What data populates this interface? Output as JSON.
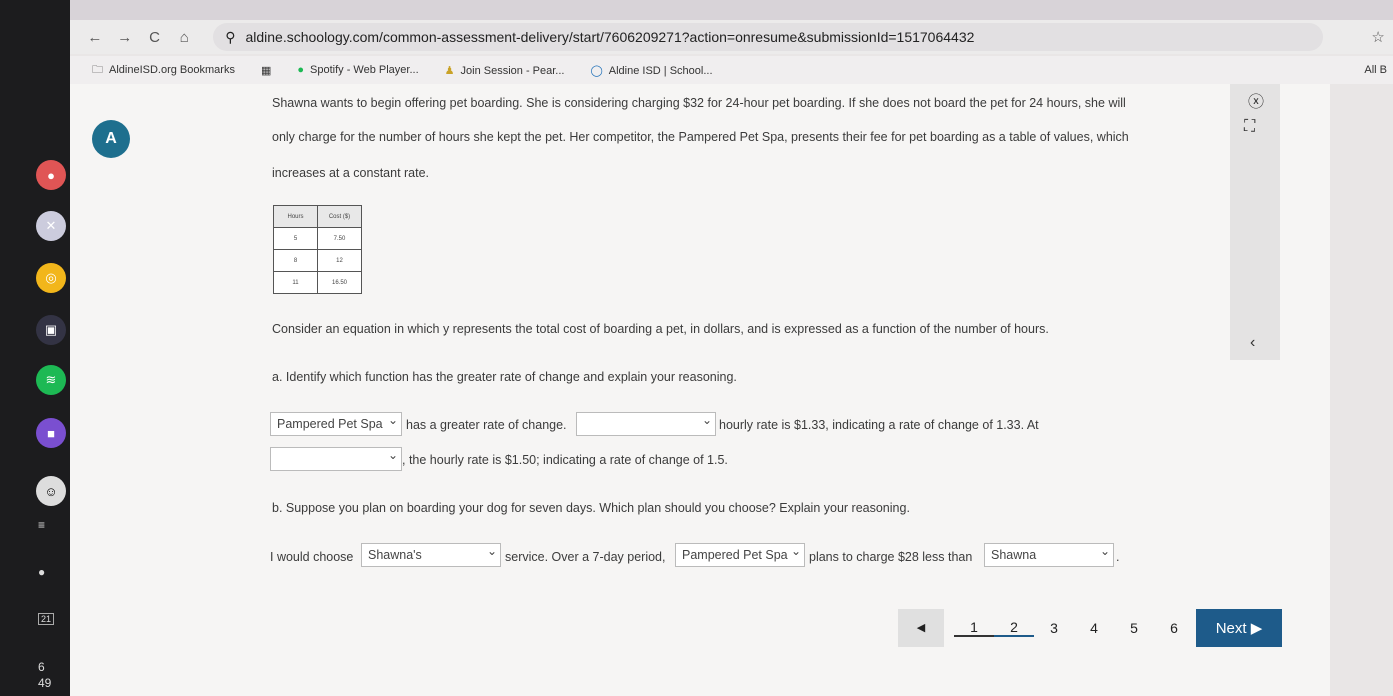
{
  "browser": {
    "url": "aldine.schoology.com/common-assessment-delivery/start/7606209271?action=onresume&submissionId=1517064432",
    "bookmarks": [
      "AldineISD.org Bookmarks",
      "Spotify - Web Player...",
      "Join Session - Pear...",
      "Aldine ISD | School..."
    ],
    "all_bookmarks": "All B"
  },
  "shelf": {
    "time_hour": "6",
    "time_min": "49",
    "calendar": "21"
  },
  "question": {
    "p1": "Shawna wants to begin offering pet boarding. She is considering charging $32 for 24-hour pet boarding. If she does not board the pet for 24 hours, she will",
    "p2": "only charge for the number of hours she kept the pet. Her competitor, the Pampered Pet Spa, presents their fee for pet boarding as a table of values, which",
    "p3": "increases at a constant rate.",
    "table": {
      "headers": [
        "Hours",
        "Cost ($)"
      ],
      "rows": [
        [
          "5",
          "7.50"
        ],
        [
          "8",
          "12"
        ],
        [
          "11",
          "16.50"
        ]
      ]
    },
    "p4": "Consider an equation in which y represents the total cost of boarding a pet, in dollars, and is expressed as a function of the number of hours.",
    "a": "a. Identify which function has the greater rate of change and explain your reasoning.",
    "a_sel1": "Pampered Pet Spa",
    "a_t1": "has a greater rate of change.",
    "a_sel2": "",
    "a_t2": "hourly rate is $1.33, indicating a rate of change of 1.33. At",
    "a_sel3": "",
    "a_t3": ", the hourly rate is $1.50; indicating a rate of change of 1.5.",
    "b": "b. Suppose you plan on boarding your dog for seven days. Which plan should you choose? Explain your reasoning.",
    "b_t1": "I would choose",
    "b_sel1": "Shawna's",
    "b_t2": "service. Over a 7-day period,",
    "b_sel2": "Pampered Pet Spa",
    "b_t3": "plans to charge $28 less than",
    "b_sel3": "Shawna",
    "b_t4": "."
  },
  "pager": {
    "prev": "◀",
    "pages": [
      "1",
      "2",
      "3",
      "4",
      "5",
      "6"
    ],
    "next": "Next ▶"
  }
}
